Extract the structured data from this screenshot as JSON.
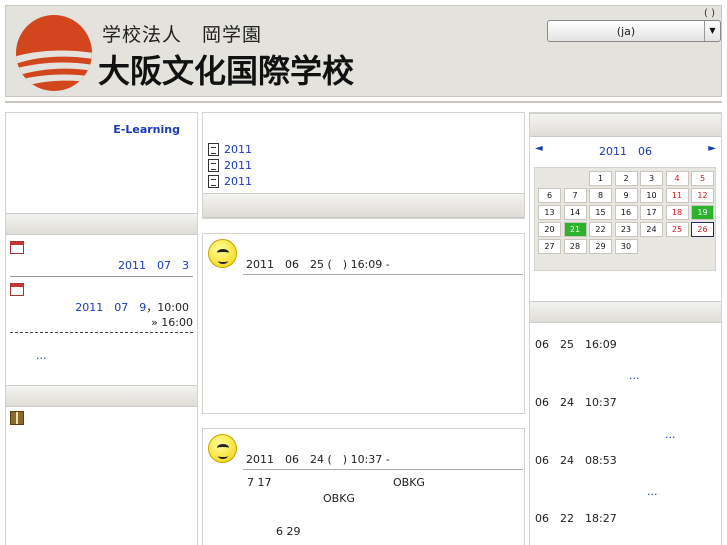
{
  "header": {
    "logo_sub": "学校法人　岡学園",
    "logo_main": "大阪文化国際学校",
    "lang_paren": "( )",
    "lang_value": "(ja)",
    "brand_color": "#d2461e"
  },
  "left": {
    "elearning": "E-Learning",
    "event1_date": "2011　07　3",
    "event2_date": "2011　07　9",
    "event2_time": "，10:00",
    "event2_end": "» 16:00",
    "more": "..."
  },
  "middle": {
    "docs": [
      "2011",
      "2011",
      "2011"
    ],
    "post1": {
      "title": "2011　06　25 (　) 16:09 -"
    },
    "post2": {
      "title": "2011　06　24 (　) 10:37 -",
      "line1_a": "7 17",
      "line1_b": "OBKG",
      "line2": "OBKG",
      "line3": "6 29"
    }
  },
  "right": {
    "calendar": {
      "prev": "◄",
      "next": "►",
      "month": "2011　06",
      "weeks": [
        [
          "",
          "",
          "1",
          "2",
          "3",
          "4",
          "5"
        ],
        [
          "6",
          "7",
          "8",
          "9",
          "10",
          "11",
          "12"
        ],
        [
          "13",
          "14",
          "15",
          "16",
          "17",
          "18",
          "19"
        ],
        [
          "20",
          "21",
          "22",
          "23",
          "24",
          "25",
          "26"
        ],
        [
          "27",
          "28",
          "29",
          "30",
          "",
          "",
          ""
        ]
      ],
      "red_days": [
        "4",
        "5",
        "11",
        "12",
        "18",
        "25",
        "26"
      ],
      "green_days": [
        "19",
        "21"
      ],
      "today": "26"
    },
    "news": [
      {
        "time": "06　25　16:09",
        "more": "..."
      },
      {
        "time": "06　24　10:37",
        "more": "..."
      },
      {
        "time": "06　24　08:53",
        "more": "..."
      },
      {
        "time": "06　22　18:27",
        "more": ""
      }
    ]
  }
}
